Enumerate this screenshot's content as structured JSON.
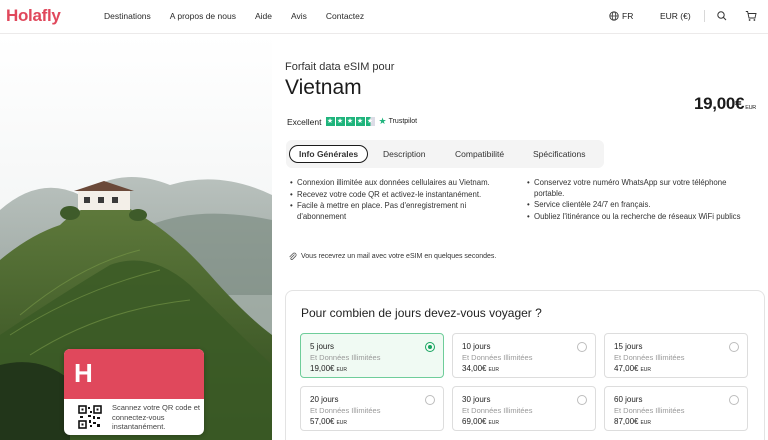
{
  "brand": {
    "logo": "Holafly",
    "accent": "#e0485c"
  },
  "nav": [
    "Destinations",
    "A propos de nous",
    "Aide",
    "Avis",
    "Contactez"
  ],
  "header": {
    "language": "FR",
    "currency": "EUR (€)",
    "icons": [
      "globe-icon",
      "search-icon",
      "cart-icon"
    ]
  },
  "hero": {
    "card": {
      "letter": "H",
      "text": "Scannez votre QR code et connectez-vous instantanément."
    }
  },
  "product": {
    "subtitle": "Forfait data eSIM pour",
    "title": "Vietnam",
    "price": "19,00€",
    "price_currency": "EUR",
    "rating_label": "Excellent",
    "trustpilot": "Trustpilot"
  },
  "tabs": [
    "Info Générales",
    "Description",
    "Compatibilité",
    "Spécifications"
  ],
  "bullets_left": [
    "Connexion illimitée aux données cellulaires au Vietnam.",
    "Recevez votre code QR et activez-le instantanément.",
    "Facile à mettre en place. Pas d'enregistrement ni d'abonnement"
  ],
  "bullets_right": [
    "Conservez votre numéro WhatsApp sur votre téléphone portable.",
    "Service clientèle 24/7 en français.",
    "Oubliez l'itinérance ou la recherche de réseaux WiFi publics"
  ],
  "info_line": "Vous recevrez un mail avec votre eSIM en quelques secondes.",
  "picker": {
    "title": "Pour combien de jours devez-vous voyager ?",
    "options": [
      {
        "days": "5 jours",
        "sub": "Et Données Illimitées",
        "price": "19,00€",
        "cur": "EUR",
        "selected": true
      },
      {
        "days": "10 jours",
        "sub": "Et Données Illimitées",
        "price": "34,00€",
        "cur": "EUR",
        "selected": false
      },
      {
        "days": "15 jours",
        "sub": "Et Données Illimitées",
        "price": "47,00€",
        "cur": "EUR",
        "selected": false
      },
      {
        "days": "20 jours",
        "sub": "Et Données Illimitées",
        "price": "57,00€",
        "cur": "EUR",
        "selected": false
      },
      {
        "days": "30 jours",
        "sub": "Et Données Illimitées",
        "price": "69,00€",
        "cur": "EUR",
        "selected": false
      },
      {
        "days": "60 jours",
        "sub": "Et Données Illimitées",
        "price": "87,00€",
        "cur": "EUR",
        "selected": false
      }
    ]
  },
  "colors": {
    "selected_border": "#6fcd9a",
    "selected_bg": "#f0faf3",
    "radio_on": "#17a45f",
    "trustpilot_green": "#1fb47c"
  }
}
